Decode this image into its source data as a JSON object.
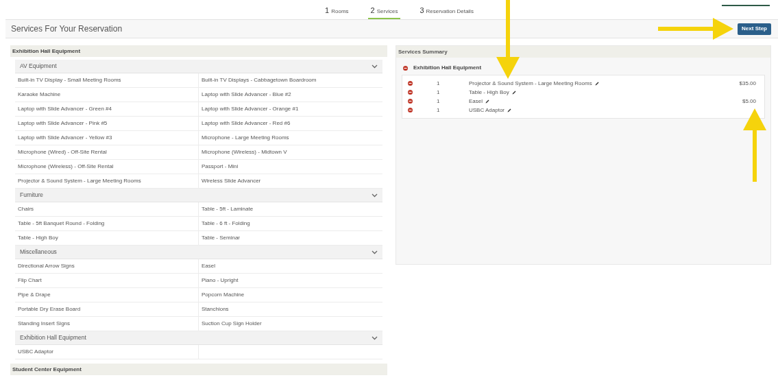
{
  "steps": [
    {
      "number": "1",
      "label": "Rooms",
      "selected": false
    },
    {
      "number": "2",
      "label": "Services",
      "selected": true
    },
    {
      "number": "3",
      "label": "Reservation Details",
      "selected": false
    }
  ],
  "header": {
    "title": "Services For Your Reservation",
    "button": "Next Step"
  },
  "sections": [
    {
      "title": "Exhibition Hall Equipment",
      "groups": [
        {
          "title": "AV Equipment",
          "expanded": true,
          "items": [
            "Built-in TV Display - Small Meeting Rooms",
            "Built-in TV Displays - Cabbagetown Boardroom",
            "Karaoke Machine",
            "Laptop with Slide Advancer - Blue #2",
            "Laptop with Slide Advancer - Green #4",
            "Laptop with Slide Advancer - Orange #1",
            "Laptop with Slide Advancer - Pink #5",
            "Laptop with Slide Advancer - Red #6",
            "Laptop with Slide Advancer - Yellow #3",
            "Microphone - Large Meeting Rooms",
            "Microphone (Wired) - Off-Site Rental",
            "Microphone (Wireless) - Midtown V",
            "Microphone (Wireless) - Off-Site Rental",
            "Passport - Mini",
            "Projector & Sound System - Large Meeting Rooms",
            "Wireless Slide Advancer"
          ]
        },
        {
          "title": "Furniture",
          "expanded": true,
          "items": [
            "Chairs",
            "Table - 5ft - Laminate",
            "Table - 5ft Banquet Round - Folding",
            "Table - 6 ft - Folding",
            "Table - High Boy",
            "Table - Seminar"
          ]
        },
        {
          "title": "Miscellaneous",
          "expanded": true,
          "items": [
            "Directional Arrow Signs",
            "Easel",
            "Flip Chart",
            "Piano - Upright",
            "Pipe & Drape",
            "Popcorn Machine",
            "Portable Dry Erase Board",
            "Stanchions",
            "Standing Insert Signs",
            "Suction Cup Sign Holder"
          ]
        },
        {
          "title": "Exhibition Hall Equipment",
          "expanded": true,
          "items": [
            "USBC Adaptor"
          ]
        }
      ]
    },
    {
      "title": "Student Center Equipment"
    }
  ],
  "summary": {
    "title": "Services Summary",
    "groups": [
      {
        "title": "Exhibition Hall Equipment",
        "items": [
          {
            "quantity": "1",
            "name": "Projector & Sound System - Large Meeting Rooms",
            "price": "$35.00"
          },
          {
            "quantity": "1",
            "name": "Table - High Boy"
          },
          {
            "quantity": "1",
            "name": "Easel",
            "price": "$5.00"
          },
          {
            "quantity": "1",
            "name": "USBC Adaptor"
          }
        ]
      }
    ]
  }
}
